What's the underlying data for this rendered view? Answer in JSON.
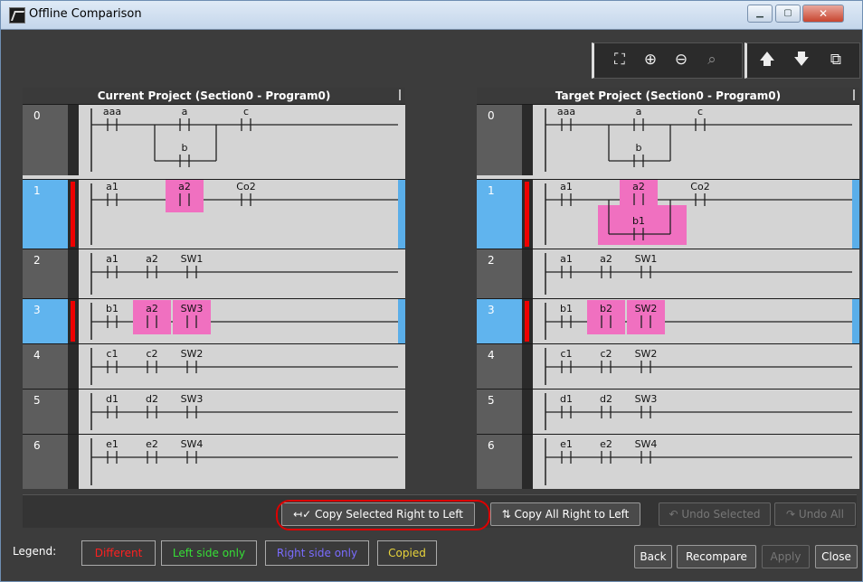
{
  "window": {
    "title": "Offline Comparison",
    "min_label": "▁",
    "max_label": "▢",
    "close_label": "✕"
  },
  "toolbar": {
    "tools": [
      {
        "name": "fit-icon",
        "glyph": "⛶"
      },
      {
        "name": "zoom-in-icon",
        "glyph": "⊕"
      },
      {
        "name": "zoom-out-icon",
        "glyph": "⊖"
      },
      {
        "name": "zoom-100-icon",
        "glyph": "⌕"
      },
      {
        "name": "arrow-up-icon",
        "glyph": "🡅"
      },
      {
        "name": "arrow-down-icon",
        "glyph": "🡇"
      },
      {
        "name": "window-icon",
        "glyph": "⧉"
      }
    ]
  },
  "left_panel": {
    "header": "Current Project (Section0 - Program0)"
  },
  "right_panel": {
    "header": "Target Project (Section0 - Program0)"
  },
  "rungs": {
    "left": [
      {
        "num": "0",
        "labels": [
          "aaa",
          "a",
          "c",
          "b"
        ]
      },
      {
        "num": "1",
        "labels": [
          "a1",
          "a2",
          "Co2"
        ]
      },
      {
        "num": "2",
        "labels": [
          "a1",
          "a2",
          "SW1"
        ]
      },
      {
        "num": "3",
        "labels": [
          "b1",
          "a2",
          "SW3"
        ]
      },
      {
        "num": "4",
        "labels": [
          "c1",
          "c2",
          "SW2"
        ]
      },
      {
        "num": "5",
        "labels": [
          "d1",
          "d2",
          "SW3"
        ]
      },
      {
        "num": "6",
        "labels": [
          "e1",
          "e2",
          "SW4"
        ]
      }
    ],
    "right": [
      {
        "num": "0",
        "labels": [
          "aaa",
          "a",
          "c",
          "b"
        ]
      },
      {
        "num": "1",
        "labels": [
          "a1",
          "a2",
          "Co2",
          "b1"
        ]
      },
      {
        "num": "2",
        "labels": [
          "a1",
          "a2",
          "SW1"
        ]
      },
      {
        "num": "3",
        "labels": [
          "b1",
          "b2",
          "SW2"
        ]
      },
      {
        "num": "4",
        "labels": [
          "c1",
          "c2",
          "SW2"
        ]
      },
      {
        "num": "5",
        "labels": [
          "d1",
          "d2",
          "SW3"
        ]
      },
      {
        "num": "6",
        "labels": [
          "e1",
          "e2",
          "SW4"
        ]
      }
    ]
  },
  "actions": {
    "copy_selected": "Copy Selected Right to Left",
    "copy_all": "Copy All Right to Left",
    "undo_selected": "Undo Selected",
    "undo_all": "Undo All"
  },
  "legend": {
    "label": "Legend:",
    "items": [
      {
        "text": "Different",
        "color": "#ff2020"
      },
      {
        "text": "Left side only",
        "color": "#36e036"
      },
      {
        "text": "Right side only",
        "color": "#7a6cff"
      },
      {
        "text": "Copied",
        "color": "#e8d43a"
      }
    ]
  },
  "footer": {
    "back": "Back",
    "recompare": "Recompare",
    "apply": "Apply",
    "close": "Close"
  },
  "colors": {
    "diff_highlight": "#f070c0",
    "selection": "#5aaee9",
    "diff_marker": "#e00000"
  }
}
